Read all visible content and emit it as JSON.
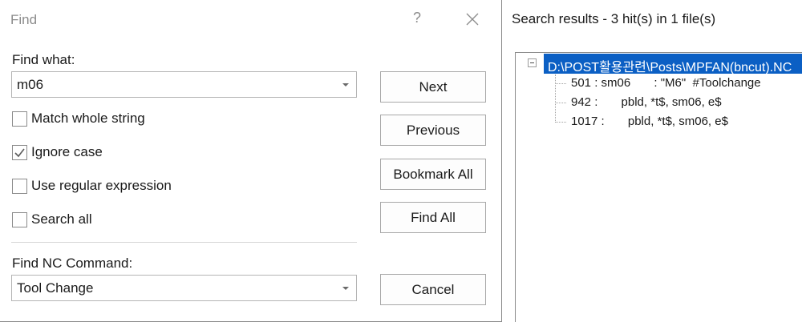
{
  "dialog": {
    "title": "Find",
    "help_label": "?",
    "find_what": {
      "label": "Find what:",
      "value": "m06"
    },
    "options": [
      {
        "label": "Match whole string",
        "checked": false
      },
      {
        "label": "Ignore case",
        "checked": true
      },
      {
        "label": "Use regular expression",
        "checked": false
      },
      {
        "label": "Search all",
        "checked": false
      }
    ],
    "nc_command": {
      "label": "Find NC Command:",
      "value": "Tool Change"
    },
    "buttons": {
      "next": "Next",
      "previous": "Previous",
      "bookmark_all": "Bookmark All",
      "find_all": "Find All",
      "cancel": "Cancel"
    }
  },
  "results": {
    "title": "Search results - 3 hit(s) in 1 file(s)",
    "file": "D:\\POST활용관련\\Posts\\MPFAN(bncut).NC",
    "hits": [
      "501 : sm06       : \"M6\"  #Toolchange",
      "942 :       pbld, *t$, sm06, e$",
      "1017 :       pbld, *t$, sm06, e$"
    ]
  }
}
